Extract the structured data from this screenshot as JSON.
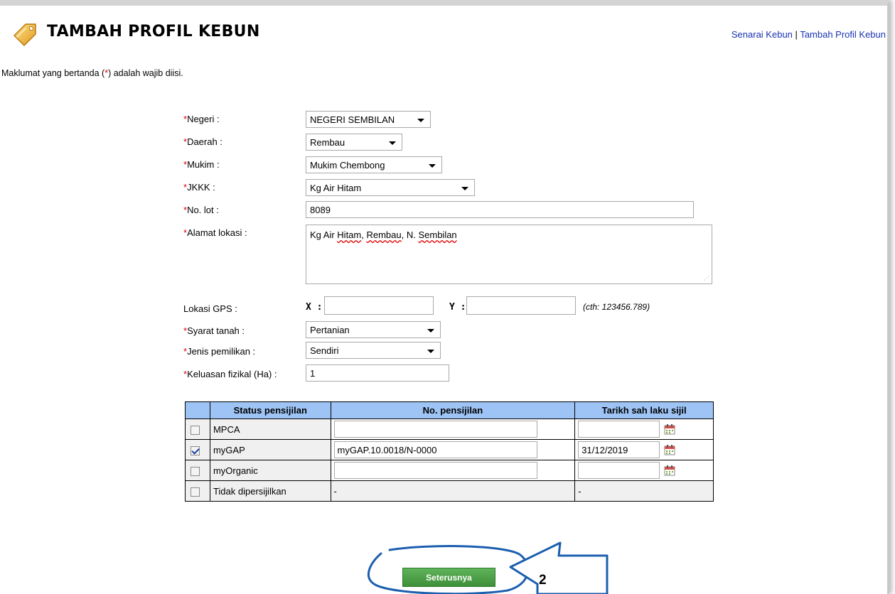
{
  "header": {
    "title": "TAMBAH PROFIL KEBUN",
    "link_list": "Senarai Kebun",
    "separator": "|",
    "link_add": "Tambah Profil Kebun"
  },
  "note": {
    "before": "Maklumat yang bertanda (",
    "star": "*",
    "after": ") adalah wajib diisi."
  },
  "form": {
    "required_mark": "*",
    "negeri": {
      "label": "Negeri :",
      "value": "NEGERI SEMBILAN"
    },
    "daerah": {
      "label": "Daerah :",
      "value": "Rembau"
    },
    "mukim": {
      "label": "Mukim :",
      "value": "Mukim Chembong"
    },
    "jkkk": {
      "label": "JKKK :",
      "value": "Kg Air Hitam"
    },
    "lot": {
      "label": "No. lot :",
      "value": "8089"
    },
    "alamat": {
      "label": "Alamat lokasi :",
      "part1": "Kg Air ",
      "part2": "Hitam",
      "part3": ", ",
      "part4": "Rembau",
      "part5": ", N. ",
      "part6": "Sembilan"
    },
    "gps": {
      "label": "Lokasi GPS :",
      "x_label": "X :",
      "x_value": "",
      "y_label": "Y :",
      "y_value": "",
      "hint": "(cth: 123456.789)"
    },
    "syarat": {
      "label": "Syarat tanah :",
      "value": "Pertanian"
    },
    "pemilikan": {
      "label": "Jenis pemilikan :",
      "value": "Sendiri"
    },
    "keluasan": {
      "label": "Keluasan fizikal (Ha) :",
      "value": "1"
    }
  },
  "cert_table": {
    "headers": [
      "",
      "Status pensijilan",
      "No. pensijilan",
      "Tarikh sah laku sijil"
    ],
    "rows": [
      {
        "status": "MPCA",
        "checked": false,
        "no": "",
        "date": ""
      },
      {
        "status": "myGAP",
        "checked": true,
        "no": "myGAP.10.0018/N-0000",
        "date": "31/12/2019"
      },
      {
        "status": "myOrganic",
        "checked": false,
        "no": "",
        "date": ""
      },
      {
        "status": "Tidak dipersijilkan",
        "checked": false,
        "no": "-",
        "date": "-"
      }
    ]
  },
  "actions": {
    "next_label": "Seterusnya"
  },
  "annotation": {
    "step_number": "2"
  },
  "colors": {
    "link": "#1a33b3",
    "required": "#e00000",
    "table_header": "#9ec4f5",
    "button": "#4ea049",
    "annotation": "#1b5fae"
  }
}
